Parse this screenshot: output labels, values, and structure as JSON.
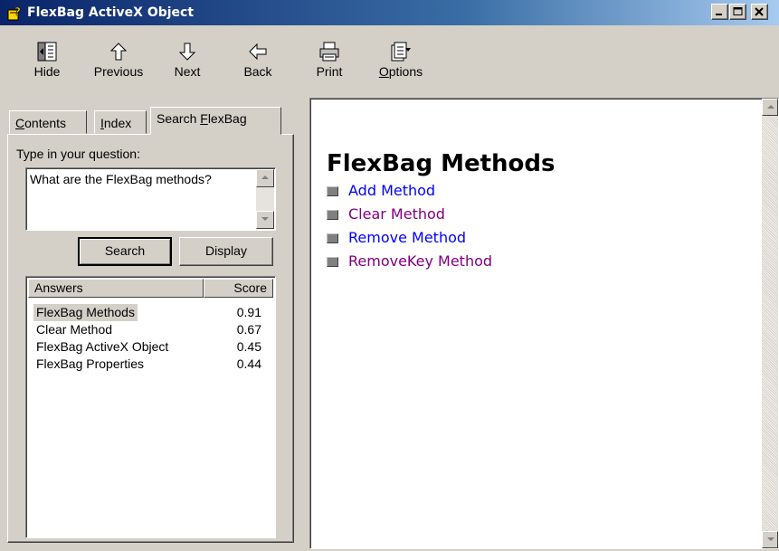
{
  "window": {
    "title": "FlexBag ActiveX Object"
  },
  "toolbar": {
    "hide": "Hide",
    "previous": "Previous",
    "next": "Next",
    "back": "Back",
    "print": "Print",
    "options_mnemonic": "O",
    "options_rest": "ptions"
  },
  "tabs": {
    "contents_mnemonic": "C",
    "contents_rest": "ontents",
    "index_mnemonic": "I",
    "index_rest": "ndex",
    "search_prefix": "Search ",
    "search_mnemonic": "F",
    "search_rest": "lexBag"
  },
  "search": {
    "prompt": "Type in your question:",
    "question": "What are the FlexBag methods?",
    "search_button": "Search",
    "display_button": "Display"
  },
  "answers": {
    "headers": {
      "answers": "Answers",
      "score": "Score"
    },
    "rows": [
      {
        "answer": "FlexBag Methods",
        "score": "0.91"
      },
      {
        "answer": "Clear Method",
        "score": "0.67"
      },
      {
        "answer": "FlexBag ActiveX Object",
        "score": "0.45"
      },
      {
        "answer": "FlexBag Properties",
        "score": "0.44"
      }
    ]
  },
  "content": {
    "title": "FlexBag Methods",
    "methods": [
      {
        "label": "Add Method",
        "visited": false
      },
      {
        "label": "Clear Method",
        "visited": true
      },
      {
        "label": "Remove Method",
        "visited": false
      },
      {
        "label": "RemoveKey Method",
        "visited": true
      }
    ]
  },
  "colors": {
    "link": "#0000ff",
    "visited_link": "#800080",
    "title_bar": "#0a246a",
    "face": "#d4d0c8"
  },
  "icons": [
    "help-book-icon",
    "hide-icon",
    "previous-arrow-icon",
    "next-arrow-icon",
    "back-arrow-icon",
    "print-icon",
    "options-icon",
    "minimize-icon",
    "maximize-icon",
    "close-icon"
  ]
}
